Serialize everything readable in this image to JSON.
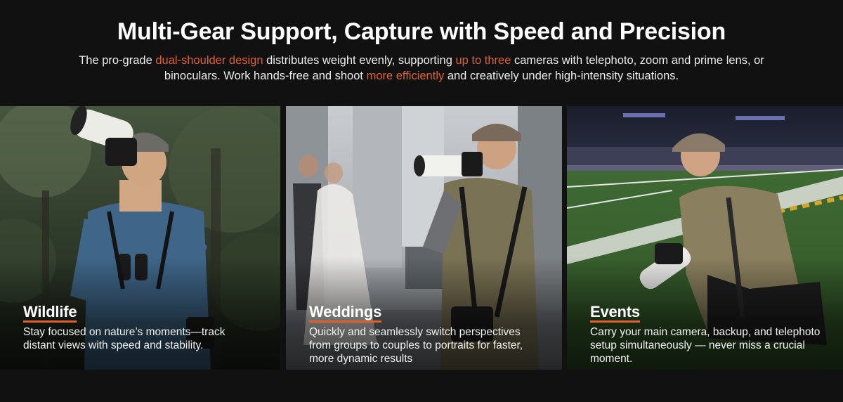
{
  "header": {
    "title": "Multi-Gear Support, Capture with Speed and Precision",
    "sub_1": "The pro-grade ",
    "sub_hl_1": "dual-shoulder design",
    "sub_2": " distributes weight evenly, supporting ",
    "sub_hl_2": "up to three",
    "sub_3": " cameras with telephoto, zoom and prime lens, or binoculars. Work hands-free and shoot ",
    "sub_hl_3": "more efficiently",
    "sub_4": " and creatively under high-intensity situations."
  },
  "accent_color": "#e2602b",
  "panels": [
    {
      "title": "Wildlife",
      "text": "Stay focused on nature’s moments—track distant views with speed and stability.",
      "scene": "forest-photographer-with-telephoto-lens"
    },
    {
      "title": "Weddings",
      "text": "Quickly and seamlessly switch perspectives from groups to couples to portraits for faster, more dynamic results",
      "scene": "wedding-photographer-with-couple-in-background"
    },
    {
      "title": "Events",
      "text": "Carry your main camera, backup, and telephoto setup simultaneously — never miss a crucial moment.",
      "scene": "stadium-photographer-kneeling-on-field"
    }
  ]
}
